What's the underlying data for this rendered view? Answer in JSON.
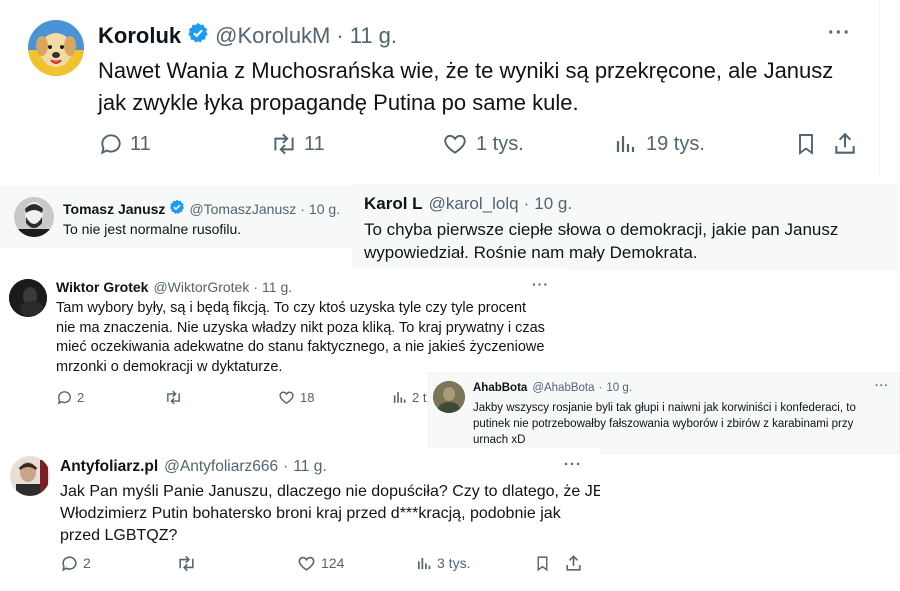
{
  "tweets": [
    {
      "name": "Koroluk",
      "handle": "@KorolukM",
      "separator": "·",
      "time": "11 g.",
      "text_lines": [
        "Nawet Wania z Muchosrańska wie, że te wyniki są przekręcone, ale Janusz",
        "jak zwykle łyka propagandę Putina po same kule."
      ],
      "replies": "11",
      "retweets": "11",
      "likes": "1 tys.",
      "views": "19 tys.",
      "more": "···"
    },
    {
      "name": "Tomasz Janusz",
      "handle": "@TomaszJanusz",
      "separator": "·",
      "time": "10 g.",
      "text": "To nie jest normalne rusofilu."
    },
    {
      "name": "Karol L",
      "handle": "@karol_lolq",
      "separator": "·",
      "time": "10 g.",
      "text_lines": [
        "To chyba pierwsze ciepłe słowa o demokracji, jakie pan Janusz",
        "wypowiedział. Rośnie nam mały Demokrata."
      ]
    },
    {
      "name": "Wiktor Grotek",
      "handle": "@WiktorGrotek",
      "separator": "·",
      "time": "11 g.",
      "text_lines": [
        "Tam wybory były, są i będą fikcją. To czy ktoś uzyska tyle czy tyle procent",
        "nie ma znaczenia. Nie uzyska władzy nikt poza kliką. To kraj prywatny i czas",
        "mieć oczekiwania adekwatne do stanu faktycznego, a nie jakieś życzeniowe",
        "mrzonki o demokracji w dyktaturze."
      ],
      "replies": "2",
      "retweets": "",
      "likes": "18",
      "views": "2 t",
      "more": "···"
    },
    {
      "name": "AhabBota",
      "handle": "@AhabBota",
      "separator": "·",
      "time": "10 g.",
      "text_lines": [
        "Jakby wszyscy rosjanie byli tak głupi i naiwni jak korwiniści i konfederaci, to",
        "putinek nie potrzebowałby fałszowania wyborów i zbirów z karabinami przy",
        "urnach xD"
      ],
      "more": "···"
    },
    {
      "name": "Antyfoliarz.pl",
      "handle": "@Antyfoliarz666",
      "separator": "·",
      "time": "11 g.",
      "text_lines": [
        "Jak Pan myśli Panie Januszu, dlaczego nie dopuściła? Czy to dlatego, że JE",
        "Włodzimierz Putin bohatersko broni kraj przed d***kracją, podobnie jak",
        "przed LGBTQZ?"
      ],
      "replies": "2",
      "retweets": "",
      "likes": "124",
      "views": "3 tys.",
      "more": "···"
    }
  ],
  "colors": {
    "verified": "#1d9bf0",
    "muted": "#536471",
    "text": "#0f1419"
  }
}
